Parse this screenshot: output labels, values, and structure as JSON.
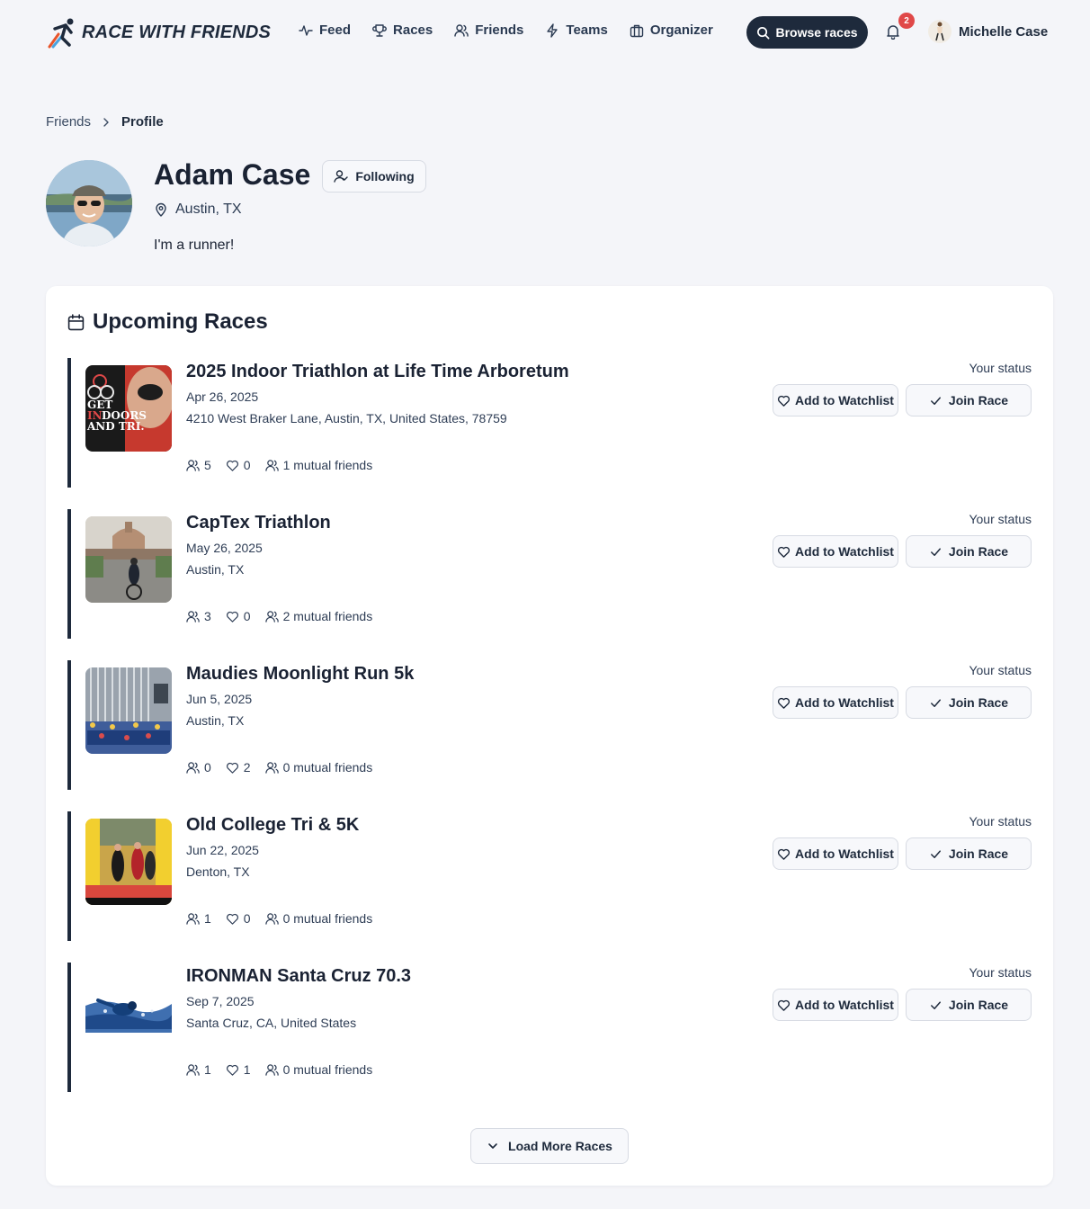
{
  "nav": {
    "brand": "RACE WITH FRIENDS",
    "links": [
      {
        "label": "Feed",
        "icon": "activity-icon"
      },
      {
        "label": "Races",
        "icon": "trophy-icon"
      },
      {
        "label": "Friends",
        "icon": "users-icon"
      },
      {
        "label": "Teams",
        "icon": "lightning-icon"
      },
      {
        "label": "Organizer",
        "icon": "briefcase-icon"
      }
    ],
    "browse_label": "Browse races",
    "notification_count": "2",
    "user_name": "Michelle Case"
  },
  "breadcrumb": {
    "parent": "Friends",
    "current": "Profile"
  },
  "profile": {
    "name": "Adam Case",
    "follow_label": "Following",
    "location": "Austin, TX",
    "bio": "I'm a runner!"
  },
  "upcoming": {
    "title": "Upcoming Races",
    "status_label": "Your status",
    "watchlist_label": "Add to Watchlist",
    "join_label": "Join Race",
    "load_more_label": "Load More Races",
    "races": [
      {
        "title": "2025 Indoor Triathlon at Life Time Arboretum",
        "date": "Apr 26, 2025",
        "location": "4210 West Braker Lane, Austin, TX, United States, 78759",
        "participants": "5",
        "likes": "0",
        "mutual": "1 mutual friends"
      },
      {
        "title": "CapTex Triathlon",
        "date": "May 26, 2025",
        "location": "Austin, TX",
        "participants": "3",
        "likes": "0",
        "mutual": "2 mutual friends"
      },
      {
        "title": "Maudies Moonlight Run 5k",
        "date": "Jun 5, 2025",
        "location": "Austin, TX",
        "participants": "0",
        "likes": "2",
        "mutual": "0 mutual friends"
      },
      {
        "title": "Old College Tri & 5K",
        "date": "Jun 22, 2025",
        "location": "Denton, TX",
        "participants": "1",
        "likes": "0",
        "mutual": "0 mutual friends"
      },
      {
        "title": "IRONMAN Santa Cruz 70.3",
        "date": "Sep 7, 2025",
        "location": "Santa Cruz, CA, United States",
        "participants": "1",
        "likes": "1",
        "mutual": "0 mutual friends"
      }
    ]
  },
  "colors": {
    "background": "#f4f5f9",
    "primary": "#1e2a3c",
    "badge": "#e04848"
  }
}
